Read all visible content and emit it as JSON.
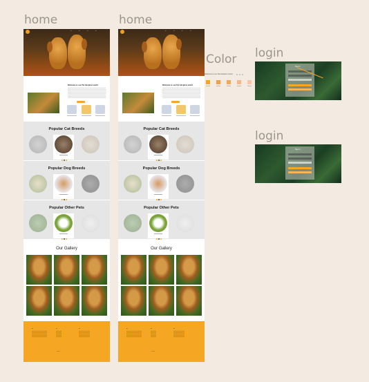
{
  "frames": [
    {
      "label": "home"
    },
    {
      "label": "home"
    },
    {
      "label": "Color"
    },
    {
      "label": "login"
    },
    {
      "label": "login"
    }
  ],
  "home": {
    "welcome_title": "Welcome to our Pet Adoption world",
    "welcome_button": "Adopt Now",
    "sections": [
      {
        "title": "Popular Cat Breeds"
      },
      {
        "title": "Popular Dog Breeds"
      },
      {
        "title": "Popular Other Pets"
      }
    ],
    "gallery_title": "Our Gallery"
  },
  "color_panel": {
    "heading": "Welcome to our Pet Adoption world",
    "swatches": [
      "#f5a623",
      "#f2a045",
      "#f4a85a",
      "#f6b68a",
      "#f9c4a8"
    ]
  },
  "login": {
    "title": "Sign in"
  },
  "colors": {
    "canvas": "#f3ebe1",
    "accent": "#f5a623",
    "section_bg": "#e6e6e6",
    "label": "#9c958d"
  }
}
